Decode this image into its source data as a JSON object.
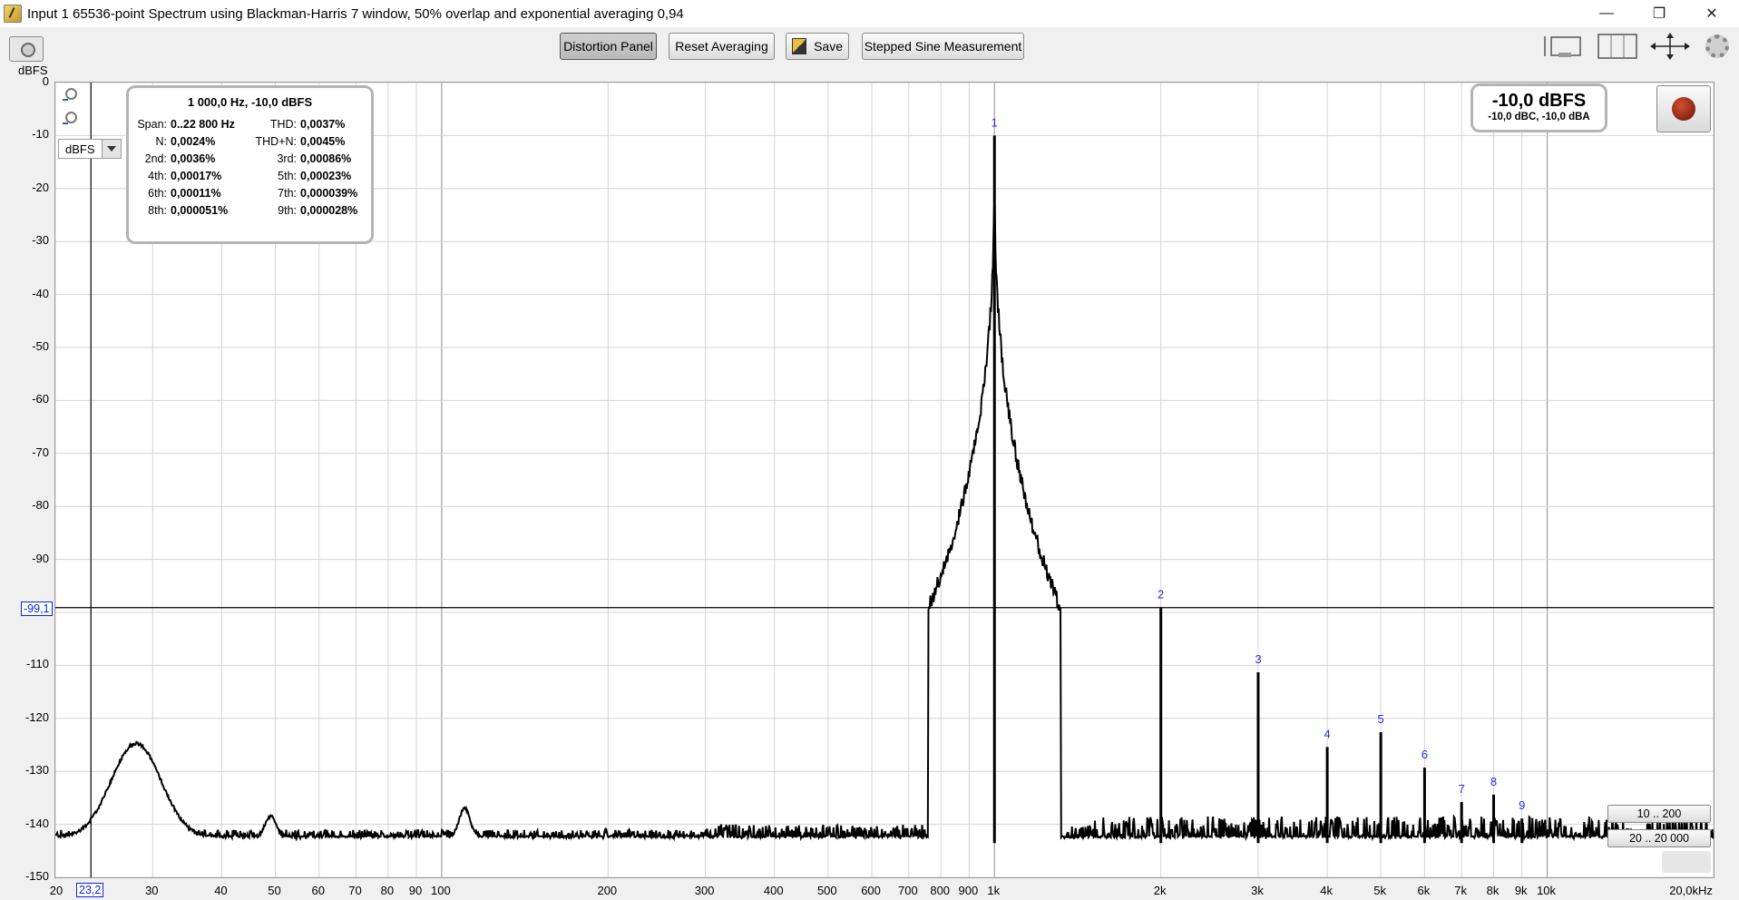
{
  "window": {
    "title": "Input 1 65536-point Spectrum using Blackman-Harris 7 window, 50% overlap and exponential averaging 0,94",
    "controls": [
      "minimize",
      "restore",
      "close"
    ]
  },
  "toolbar": {
    "distortion_panel": "Distortion Panel",
    "reset_averaging": "Reset Averaging",
    "save": "Save",
    "stepped_sine": "Stepped Sine Measurement"
  },
  "plot": {
    "unit_select": "dBFS",
    "y_unit_label": "dBFS",
    "cursor_y_value": "-99,1",
    "cursor_x_value": "23,2",
    "range_buttons": [
      "10 .. 200",
      "20 .. 20 000"
    ]
  },
  "info_panel": {
    "header": "1 000,0 Hz, -10,0 dBFS",
    "rows": [
      {
        "label": "Span:",
        "value": "0..22 800 Hz",
        "label2": "THD:",
        "value2": "0,0037%"
      },
      {
        "label": "N:",
        "value": "0,0024%",
        "label2": "THD+N:",
        "value2": "0,0045%"
      },
      {
        "label": "2nd:",
        "value": "0,0036%",
        "label2": "3rd:",
        "value2": "0,00086%"
      },
      {
        "label": "4th:",
        "value": "0,00017%",
        "label2": "5th:",
        "value2": "0,00023%"
      },
      {
        "label": "6th:",
        "value": "0,00011%",
        "label2": "7th:",
        "value2": "0,000039%"
      },
      {
        "label": "8th:",
        "value": "0,000051%",
        "label2": "9th:",
        "value2": "0,000028%"
      }
    ]
  },
  "level_panel": {
    "main": "-10,0 dBFS",
    "sub": "-10,0 dBC, -10,0 dBA"
  },
  "chart_data": {
    "type": "line",
    "title": "",
    "xlabel": "",
    "ylabel": "dBFS",
    "x_scale": "log",
    "xlim": [
      20,
      20000
    ],
    "ylim": [
      -150,
      0
    ],
    "grid": true,
    "x_ticks": [
      "20",
      "30",
      "40",
      "50",
      "60",
      "70",
      "80",
      "90",
      "100",
      "200",
      "300",
      "400",
      "500",
      "600",
      "700",
      "800",
      "900",
      "1k",
      "2k",
      "3k",
      "4k",
      "5k",
      "6k",
      "7k",
      "8k",
      "9k",
      "10k",
      "20,0kHz"
    ],
    "y_ticks": [
      "0",
      "-10",
      "-20",
      "-30",
      "-40",
      "-50",
      "-60",
      "-70",
      "-80",
      "-90",
      "-100",
      "-110",
      "-120",
      "-130",
      "-140",
      "-150"
    ],
    "series": [
      {
        "name": "",
        "noise_floor_db": -142.5,
        "features": [
          {
            "x": 28,
            "y": -124.7
          },
          {
            "x": 49,
            "y": -138.5
          },
          {
            "x": 110,
            "y": -137
          }
        ]
      }
    ],
    "harmonics": [
      {
        "label": "1",
        "x": 1000,
        "y": -10
      },
      {
        "label": "2",
        "x": 2000,
        "y": -99.1
      },
      {
        "label": "3",
        "x": 3000,
        "y": -111.3
      },
      {
        "label": "4",
        "x": 4000,
        "y": -125.4
      },
      {
        "label": "5",
        "x": 5000,
        "y": -122.6
      },
      {
        "label": "6",
        "x": 6000,
        "y": -129.3
      },
      {
        "label": "7",
        "x": 7000,
        "y": -135.8
      },
      {
        "label": "8",
        "x": 8000,
        "y": -134.4
      },
      {
        "label": "9",
        "x": 9000,
        "y": -138.9
      }
    ],
    "cursor": {
      "x": 23.2,
      "y": -99.1
    }
  }
}
